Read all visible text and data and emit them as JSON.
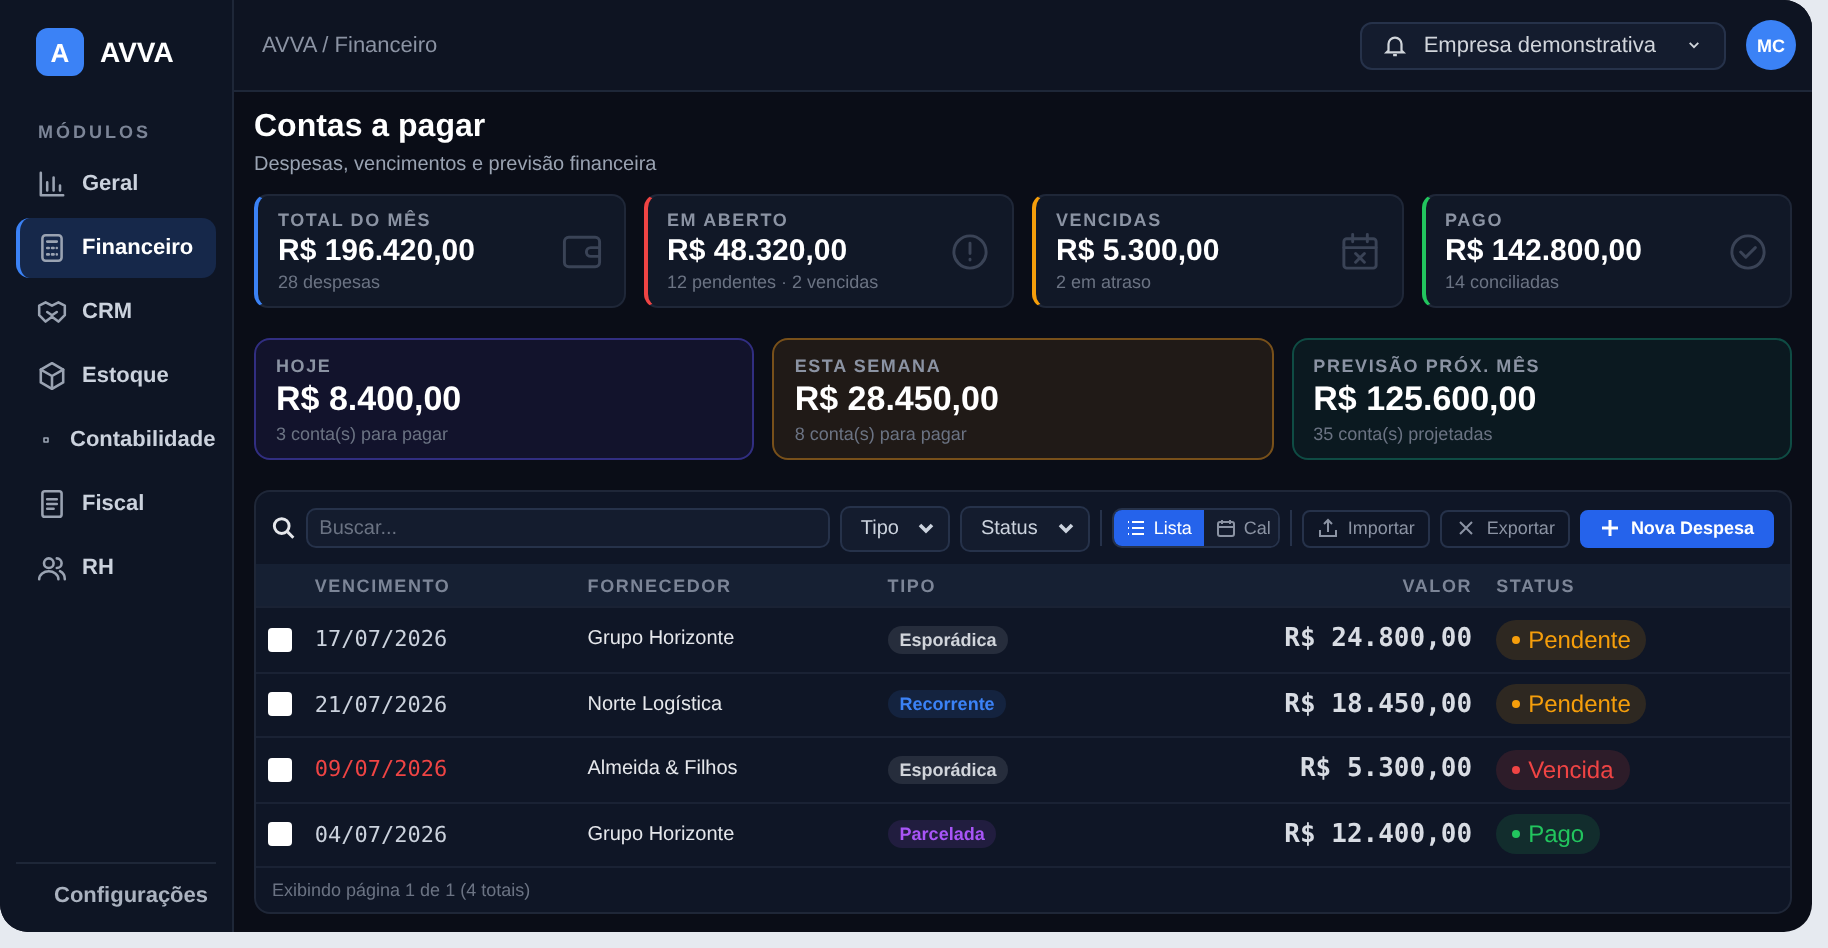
{
  "brand": {
    "logo": "A",
    "name": "AVVA"
  },
  "sidebar": {
    "section": "MÓDULOS",
    "items": [
      {
        "label": "Geral",
        "selected": false
      },
      {
        "label": "Financeiro",
        "selected": true
      },
      {
        "label": "CRM",
        "selected": false
      },
      {
        "label": "Estoque",
        "selected": false
      },
      {
        "label": "Contabilidade",
        "selected": false
      },
      {
        "label": "Fiscal",
        "selected": false
      },
      {
        "label": "RH",
        "selected": false
      }
    ],
    "footer": "Configurações"
  },
  "breadcrumb": "AVVA / Financeiro",
  "company_selector": "Empresa demonstrativa",
  "avatar": "MC",
  "page": {
    "title": "Contas a pagar",
    "subtitle": "Despesas, vencimentos e previsão financeira"
  },
  "summary_cards": [
    {
      "label": "TOTAL DO MÊS",
      "value": "R$ 196.420,00",
      "note": "28 despesas",
      "color": "#3b82f6"
    },
    {
      "label": "EM ABERTO",
      "value": "R$ 48.320,00",
      "note": "12 pendentes · 2 vencidas",
      "color": "#ef4444"
    },
    {
      "label": "VENCIDAS",
      "value": "R$ 5.300,00",
      "note": "2 em atraso",
      "color": "#f59e0b"
    },
    {
      "label": "PAGO",
      "value": "R$ 142.800,00",
      "note": "14 conciliadas",
      "color": "#22c55e"
    }
  ],
  "forecast_cards": [
    {
      "label": "HOJE",
      "value": "R$ 8.400,00",
      "note": "3 conta(s) para pagar",
      "color": "#312e81"
    },
    {
      "label": "ESTA SEMANA",
      "value": "R$ 28.450,00",
      "note": "8 conta(s) para pagar",
      "color": "#78501a"
    },
    {
      "label": "PREVISÃO PRÓX. MÊS",
      "value": "R$ 125.600,00",
      "note": "35 conta(s) projetadas",
      "color": "#0f4c44"
    }
  ],
  "toolbar": {
    "search": {
      "placeholder": "Buscar..."
    },
    "filters": [
      "Tipo",
      "Status"
    ],
    "views": [
      {
        "label": "Lista",
        "selected": true
      },
      {
        "label": "Cal",
        "selected": false
      }
    ],
    "buttons": [
      {
        "label": "Importar",
        "kind": "outline"
      },
      {
        "label": "Exportar",
        "kind": "outline"
      },
      {
        "label": "Nova Despesa",
        "kind": "primary"
      }
    ]
  },
  "table": {
    "columns": [
      "VENCIMENTO",
      "FORNECEDOR",
      "TIPO",
      "VALOR",
      "STATUS"
    ],
    "rows": [
      {
        "checked": false,
        "due": "17/07/2026",
        "overdue": false,
        "supplier": "Grupo Horizonte",
        "type": {
          "label": "Esporádica",
          "color": "#d1d5db"
        },
        "value": "R$ 24.800,00",
        "status": {
          "label": "Pendente",
          "color": "#f59e0b"
        }
      },
      {
        "checked": false,
        "due": "21/07/2026",
        "overdue": false,
        "supplier": "Norte Logística",
        "type": {
          "label": "Recorrente",
          "color": "#3b82f6"
        },
        "value": "R$ 18.450,00",
        "status": {
          "label": "Pendente",
          "color": "#f59e0b"
        }
      },
      {
        "checked": false,
        "due": "09/07/2026",
        "overdue": true,
        "supplier": "Almeida & Filhos",
        "type": {
          "label": "Esporádica",
          "color": "#d1d5db"
        },
        "value": "R$ 5.300,00",
        "status": {
          "label": "Vencida",
          "color": "#ef4444"
        }
      },
      {
        "checked": false,
        "due": "04/07/2026",
        "overdue": false,
        "supplier": "Grupo Horizonte",
        "type": {
          "label": "Parcelada",
          "color": "#a855f7"
        },
        "value": "R$ 12.400,00",
        "status": {
          "label": "Pago",
          "color": "#22c55e"
        }
      }
    ],
    "footer": "Exibindo página 1 de 1 (4 totais)"
  }
}
